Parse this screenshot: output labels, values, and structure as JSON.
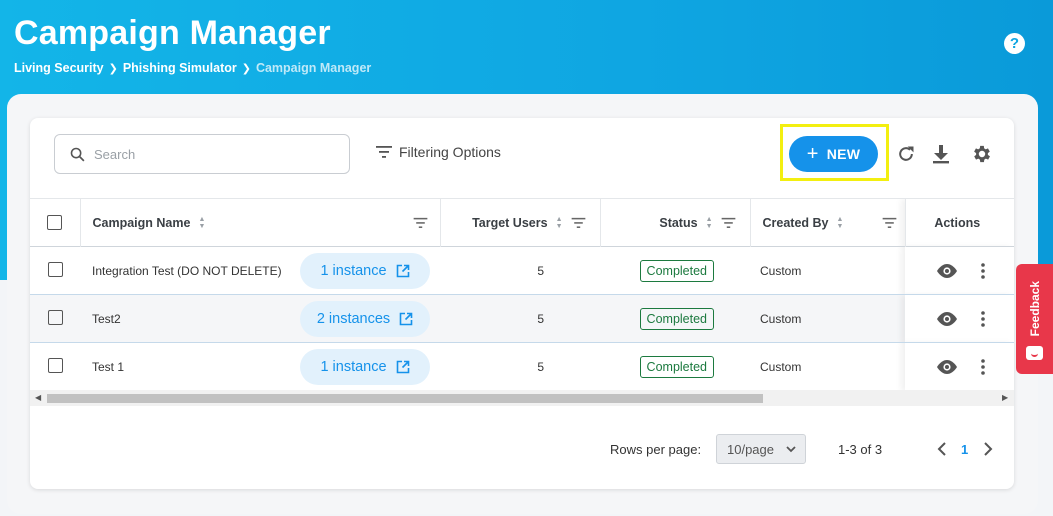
{
  "header": {
    "title": "Campaign Manager",
    "breadcrumb": [
      "Living Security",
      "Phishing Simulator",
      "Campaign Manager"
    ]
  },
  "toolbar": {
    "search_placeholder": "Search",
    "filter_label": "Filtering Options",
    "new_label": "NEW"
  },
  "table": {
    "columns": [
      "Campaign Name",
      "Target Users",
      "Status",
      "Created By",
      "Actions"
    ],
    "rows": [
      {
        "name": "Integration Test (DO NOT DELETE)",
        "instances": "1 instance",
        "target_users": "5",
        "status": "Completed",
        "created_by": "Custom"
      },
      {
        "name": "Test2",
        "instances": "2 instances",
        "target_users": "5",
        "status": "Completed",
        "created_by": "Custom"
      },
      {
        "name": "Test 1",
        "instances": "1 instance",
        "target_users": "5",
        "status": "Completed",
        "created_by": "Custom"
      }
    ]
  },
  "pagination": {
    "rows_per_page_label": "Rows per page:",
    "rows_per_page_value": "10/page",
    "range": "1-3 of 3",
    "current_page": "1"
  },
  "feedback_label": "Feedback",
  "colors": {
    "primary": "#1592ea",
    "header_bg": "#0fa6e2",
    "status_green": "#1c7a3f",
    "feedback_red": "#e8374a",
    "highlight": "#f3ef10"
  }
}
